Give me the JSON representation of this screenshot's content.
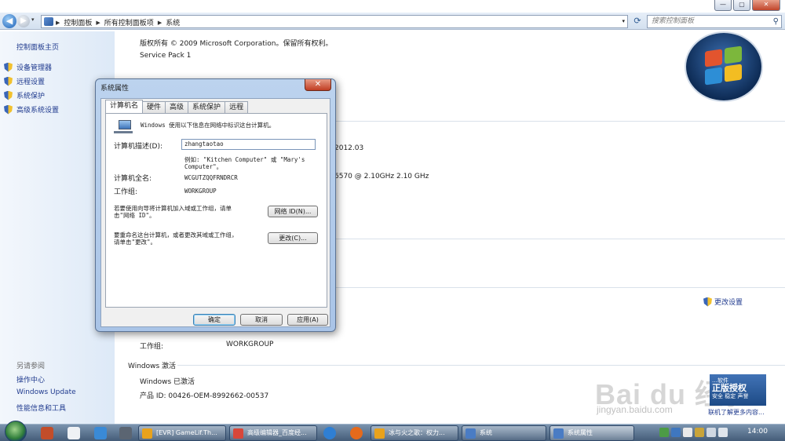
{
  "window": {
    "min_glyph": "—",
    "max_glyph": "▢",
    "close_glyph": "✕"
  },
  "address": {
    "back_glyph": "◀",
    "forward_glyph": "▶",
    "drop_glyph": "▾",
    "crumbs": [
      "控制面板",
      "所有控制面板项",
      "系统"
    ],
    "separator": "▶",
    "refresh_glyph": "⟳",
    "search_placeholder": "搜索控制面板",
    "search_glyph": "⚲"
  },
  "sidebar": {
    "home": "控制面板主页",
    "tasks": [
      "设备管理器",
      "远程设置",
      "系统保护",
      "高级系统设置"
    ],
    "see_also_title": "另请参阅",
    "see_also": [
      "操作中心",
      "Windows Update",
      "性能信息和工具"
    ]
  },
  "main": {
    "copyright": "版权所有 © 2009 Microsoft Corporation。保留所有权利。",
    "service_pack": "Service Pack 1",
    "partial_rating": "2012.03",
    "partial_cpu": "6570  @ 2.10GHz   2.10 GHz",
    "change_settings": "更改设置",
    "workgroup_label": "工作组:",
    "workgroup_value": "WORKGROUP",
    "activation_title": "Windows 激活",
    "activation_status": "Windows 已激活",
    "product_id": "产品 ID: 00426-OEM-8992662-00537"
  },
  "genuine": {
    "line1": "…软件",
    "title": "正版授权",
    "line3": "安全 稳定 声誉",
    "link": "联机了解更多内容..."
  },
  "watermark": {
    "brand": "Bai du 经验",
    "url": "jingyan.baidu.com"
  },
  "dialog": {
    "title": "系统属性",
    "close_glyph": "✕",
    "tabs": [
      "计算机名",
      "硬件",
      "高级",
      "系统保护",
      "远程"
    ],
    "active_tab": 0,
    "intro": "Windows 使用以下信息在网络中标识这台计算机。",
    "description_label": "计算机描述(D):",
    "description_value": "zhangtaotao",
    "example_line1": "例如: \"Kitchen Computer\" 或 \"Mary's",
    "example_line2": "Computer\"。",
    "fullname_label": "计算机全名:",
    "fullname_value": "WCGUTZQQFRNDRCR",
    "workgroup_label": "工作组:",
    "workgroup_value": "WORKGROUP",
    "wizard_line1": "若要使用向导将计算机加入域或工作组，请单",
    "wizard_line2": "击\"网络 ID\"。",
    "network_id_button": "网络 ID(N)...",
    "rename_line1": "要重命名这台计算机，或者更改其域或工作组，",
    "rename_line2": "请单击\"更改\"。",
    "change_button": "更改(C)...",
    "ok_button": "确定",
    "cancel_button": "取消",
    "apply_button": "应用(A)"
  },
  "taskbar": {
    "buttons": [
      {
        "label": "[EVR] GameLif.Th...",
        "color": "#e8a21c"
      },
      {
        "label": "高级编辑器_百度经...",
        "color": "#d8473a"
      },
      {
        "label": "冰与火之歌：权力...",
        "color": "#e8a21c"
      },
      {
        "label": "系统",
        "color": "#4a7cc4"
      },
      {
        "label": "系统属性",
        "color": "#4a7cc4"
      }
    ],
    "clock": "14:00"
  }
}
